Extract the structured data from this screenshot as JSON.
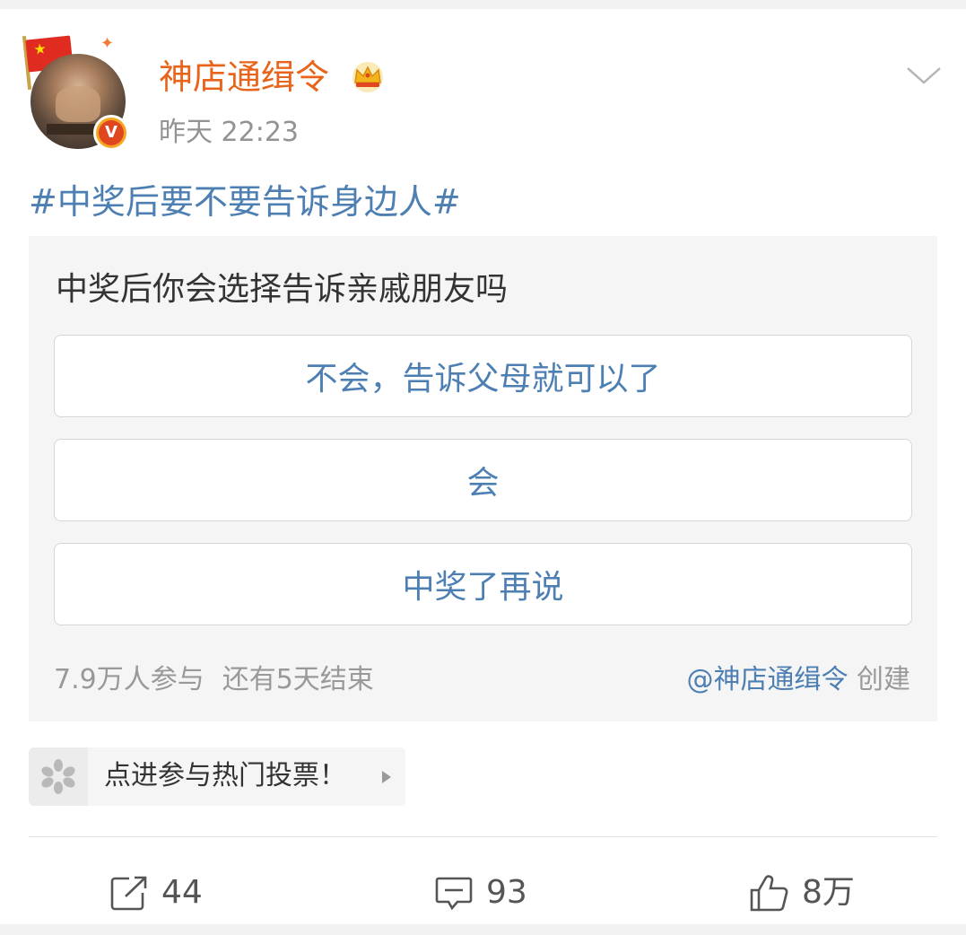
{
  "post": {
    "username": "神店通缉令",
    "timestamp": "昨天 22:23",
    "topic": "#中奖后要不要告诉身边人#",
    "verified_badge_letter": "V"
  },
  "poll": {
    "question": "中奖后你会选择告诉亲戚朋友吗",
    "options": [
      {
        "label": "不会，告诉父母就可以了"
      },
      {
        "label": "会"
      },
      {
        "label": "中奖了再说"
      }
    ],
    "participants": "7.9万人参与",
    "time_left": "还有5天结束",
    "creator": "@神店通缉令",
    "created_label": "创建"
  },
  "hot_vote": {
    "label": "点进参与热门投票！"
  },
  "actions": {
    "repost_count": "44",
    "comment_count": "93",
    "like_count": "8万"
  },
  "colors": {
    "username": "#e8641b",
    "link_blue": "#4e7fb3",
    "muted_gray": "#999999",
    "poll_bg": "#f5f5f5"
  },
  "icons": {
    "menu": "chevron-down-icon",
    "repost": "share-icon",
    "comment": "comment-icon",
    "like": "thumbs-up-icon",
    "hot_vote": "flower-icon",
    "crown": "crown-icon"
  }
}
